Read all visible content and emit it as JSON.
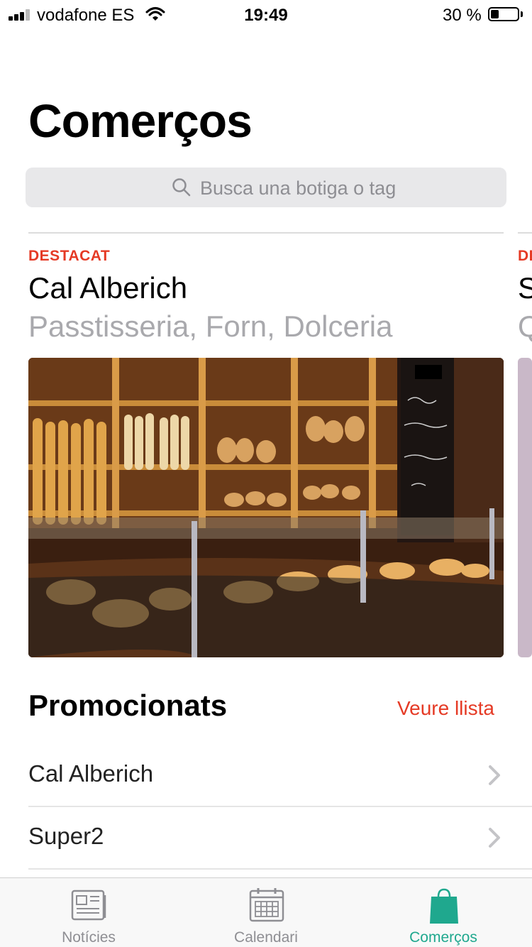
{
  "status_bar": {
    "carrier": "vodafone ES",
    "time": "19:49",
    "battery_percent": "30 %",
    "battery_level": 0.3
  },
  "page_title": "Comerços",
  "search": {
    "placeholder": "Busca una botiga o tag"
  },
  "featured": [
    {
      "label": "DESTACAT",
      "name": "Cal Alberich",
      "tags": "Passtisseria, Forn, Dolceria",
      "image": "bakery-counter-photo"
    },
    {
      "label": "DE",
      "name": "S",
      "tags": "Q",
      "image": "shop-photo"
    }
  ],
  "promoted": {
    "title": "Promocionats",
    "see_all": "Veure llista",
    "items": [
      {
        "label": "Cal Alberich"
      },
      {
        "label": "Super2"
      }
    ]
  },
  "tab_bar": {
    "tabs": [
      {
        "label": "Notícies",
        "icon": "newspaper-icon",
        "active": false
      },
      {
        "label": "Calendari",
        "icon": "calendar-icon",
        "active": false
      },
      {
        "label": "Comerços",
        "icon": "shopping-bag-icon",
        "active": true
      }
    ]
  },
  "colors": {
    "accent_red": "#e53a25",
    "tab_active": "#1fa88e",
    "tab_inactive": "#8e8e93"
  }
}
